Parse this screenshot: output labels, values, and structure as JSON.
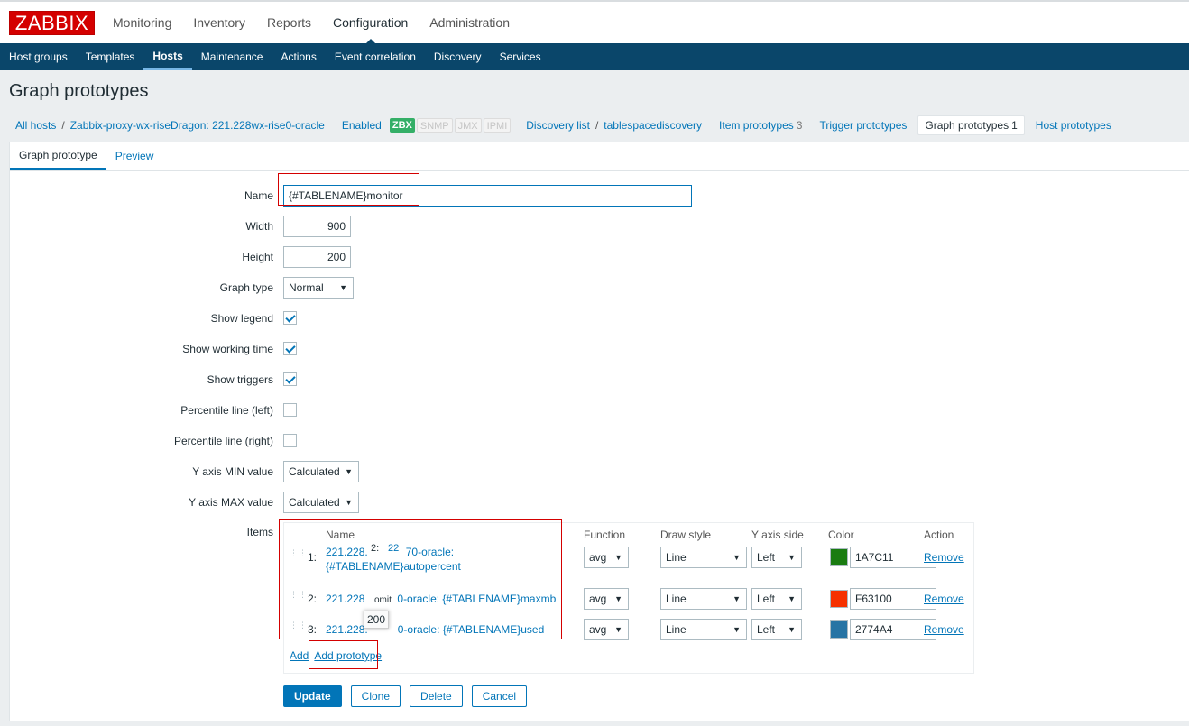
{
  "logo": "ZABBIX",
  "main_nav": [
    {
      "label": "Monitoring"
    },
    {
      "label": "Inventory"
    },
    {
      "label": "Reports"
    },
    {
      "label": "Configuration"
    },
    {
      "label": "Administration"
    }
  ],
  "sub_nav": [
    {
      "label": "Host groups"
    },
    {
      "label": "Templates"
    },
    {
      "label": "Hosts"
    },
    {
      "label": "Maintenance"
    },
    {
      "label": "Actions"
    },
    {
      "label": "Event correlation"
    },
    {
      "label": "Discovery"
    },
    {
      "label": "Services"
    }
  ],
  "page_title": "Graph prototypes",
  "breadcrumbs": {
    "all_hosts": "All hosts",
    "host": "Zabbix-proxy-wx-riseDragon: 221.228wx-rise0-oracle",
    "status": "Enabled",
    "badges": [
      "ZBX",
      "SNMP",
      "JMX",
      "IPMI"
    ],
    "discovery_list": "Discovery list",
    "discovery_rule": "tablespacediscovery",
    "item_prototypes": "Item prototypes",
    "item_prototypes_count": "3",
    "trigger_prototypes": "Trigger prototypes",
    "graph_prototypes": "Graph prototypes",
    "graph_prototypes_count": "1",
    "host_prototypes": "Host prototypes"
  },
  "tabs": [
    "Graph prototype",
    "Preview"
  ],
  "form": {
    "name_label": "Name",
    "name_value": "{#TABLENAME}monitor",
    "width_label": "Width",
    "width_value": "900",
    "height_label": "Height",
    "height_value": "200",
    "graph_type_label": "Graph type",
    "graph_type_value": "Normal",
    "show_legend_label": "Show legend",
    "show_working_time_label": "Show working time",
    "show_triggers_label": "Show triggers",
    "percentile_left_label": "Percentile line (left)",
    "percentile_right_label": "Percentile line (right)",
    "ymin_label": "Y axis MIN value",
    "ymin_value": "Calculated",
    "ymax_label": "Y axis MAX value",
    "ymax_value": "Calculated",
    "items_label": "Items"
  },
  "items_table": {
    "headers": {
      "name": "Name",
      "function": "Function",
      "draw_style": "Draw style",
      "y_axis_side": "Y axis side",
      "color": "Color",
      "action": "Action"
    },
    "rows": [
      {
        "num": "1:",
        "name_a": "221.228.",
        "name_b": "70-oracle:",
        "name_c": "{#TABLENAME}autopercent",
        "function": "avg",
        "draw_style": "Line",
        "y_axis_side": "Left",
        "color": "1A7C11",
        "swatch": "#1A7C11",
        "remove": "Remove"
      },
      {
        "num": "2:",
        "name_a": "221.228",
        "name_b": "0-oracle: {#TABLENAME}maxmb",
        "function": "avg",
        "draw_style": "Line",
        "y_axis_side": "Left",
        "color": "F63100",
        "swatch": "#F63100",
        "remove": "Remove"
      },
      {
        "num": "3:",
        "name_a": "221.228.",
        "name_b": "0-oracle: {#TABLENAME}used",
        "function": "avg",
        "draw_style": "Line",
        "y_axis_side": "Left",
        "color": "2774A4",
        "swatch": "#2774A4",
        "remove": "Remove"
      }
    ],
    "add": "Add",
    "add_prototype": "Add prototype",
    "overlay_a": "2:",
    "overlay_b": "22",
    "overlay_c": "omit",
    "overlay_d": "200"
  },
  "buttons": {
    "update": "Update",
    "clone": "Clone",
    "delete": "Delete",
    "cancel": "Cancel"
  },
  "colors": {
    "brand": "#d40000",
    "nav_bg": "#0a466a",
    "link": "#0275b8",
    "enabled": "#429e47",
    "badge_on": "#34af67"
  }
}
